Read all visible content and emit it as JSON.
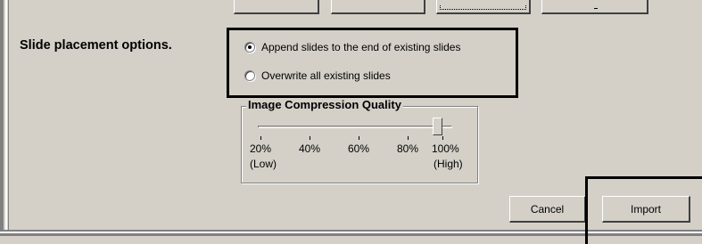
{
  "placement": {
    "heading": "Slide placement options.",
    "options": [
      {
        "label": "Append slides to the end of existing slides",
        "selected": true
      },
      {
        "label": "Overwrite all existing slides",
        "selected": false
      }
    ]
  },
  "compression": {
    "title": "Image Compression Quality",
    "value_percent": 100,
    "ticks": [
      "20%",
      "40%",
      "60%",
      "80%",
      "100%"
    ],
    "low_label": "(Low)",
    "high_label": "(High)"
  },
  "buttons": {
    "cancel": "Cancel",
    "import": "Import"
  }
}
